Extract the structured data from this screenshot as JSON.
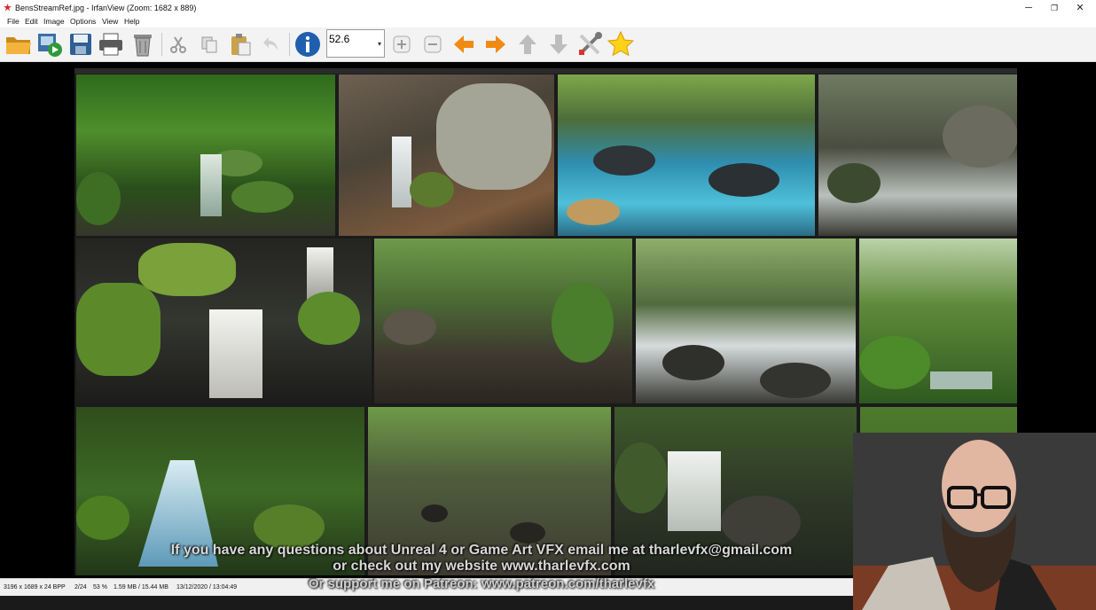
{
  "window": {
    "title": "BensStreamRef.jpg - IrfanView (Zoom: 1682 x 889)",
    "minimize": "─",
    "maximize": "❐",
    "close": "✕"
  },
  "menu": [
    "File",
    "Edit",
    "Image",
    "Options",
    "View",
    "Help"
  ],
  "toolbar": {
    "zoom_value": "52.6",
    "icons": [
      "open-folder-icon",
      "slideshow-icon",
      "save-icon",
      "print-icon",
      "delete-icon",
      "cut-icon",
      "copy-icon",
      "paste-icon",
      "undo-icon",
      "info-icon",
      "zoom-in-icon",
      "zoom-out-icon",
      "previous-arrow-icon",
      "next-arrow-icon",
      "up-arrow-icon",
      "down-arrow-icon",
      "settings-tools-icon",
      "favorite-star-icon"
    ]
  },
  "overlay": {
    "line1": "If you have any questions about Unreal 4 or Game Art VFX email me at tharlevfx@gmail.com",
    "line2": "or check out my website www.tharlevfx.com",
    "line3": "Or support me on Patreon: www.patreon.com/tharlevfx"
  },
  "status": {
    "dimensions": "3196 x 1689 x 24 BPP",
    "index": "2/24",
    "zoom": "53 %",
    "size": "1.59 MB / 15.44 MB",
    "datetime": "13/12/2020 / 13:04:49"
  },
  "colors": {
    "moss": "#3f6b26",
    "water": "#cfe3ea",
    "rock": "#4a4a44",
    "teal_water": "#37a6c4"
  }
}
